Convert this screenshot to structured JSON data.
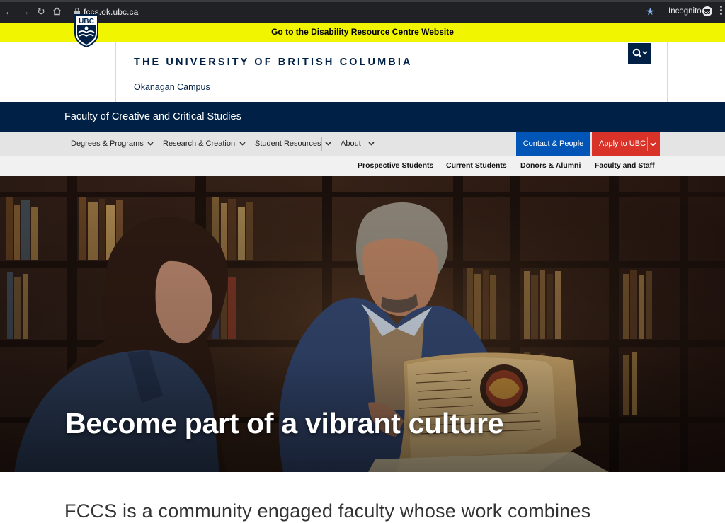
{
  "browser": {
    "url": "fccs.ok.ubc.ca",
    "mode_label": "Incognito",
    "icons": [
      "back-arrow-icon",
      "forward-arrow-icon",
      "reload-icon",
      "home-icon",
      "lock-icon",
      "star-icon",
      "incognito-icon",
      "more-vert-icon"
    ]
  },
  "banner": {
    "link_text": "Go to the Disability Resource Centre Website",
    "bg_color": "#f2f500"
  },
  "header": {
    "crest_text": "UBC",
    "university_name": "THE UNIVERSITY OF BRITISH COLUMBIA",
    "campus": "Okanagan Campus",
    "brand_color": "#002145"
  },
  "faculty": {
    "title": "Faculty of Creative and Critical Studies"
  },
  "main_nav": {
    "items": [
      {
        "label": "Degrees & Programs"
      },
      {
        "label": "Research & Creation"
      },
      {
        "label": "Student Resources"
      },
      {
        "label": "About"
      }
    ],
    "contact_label": "Contact & People",
    "apply_label": "Apply to UBC",
    "contact_color": "#0055b7",
    "apply_color": "#d93228"
  },
  "audience_nav": {
    "items": [
      {
        "label": "Prospective Students"
      },
      {
        "label": "Current Students"
      },
      {
        "label": "Donors & Alumni"
      },
      {
        "label": "Faculty and Staff"
      }
    ]
  },
  "hero": {
    "title": "Become part of a vibrant culture"
  },
  "intro": {
    "text": "FCCS is a community engaged faculty whose work combines"
  }
}
